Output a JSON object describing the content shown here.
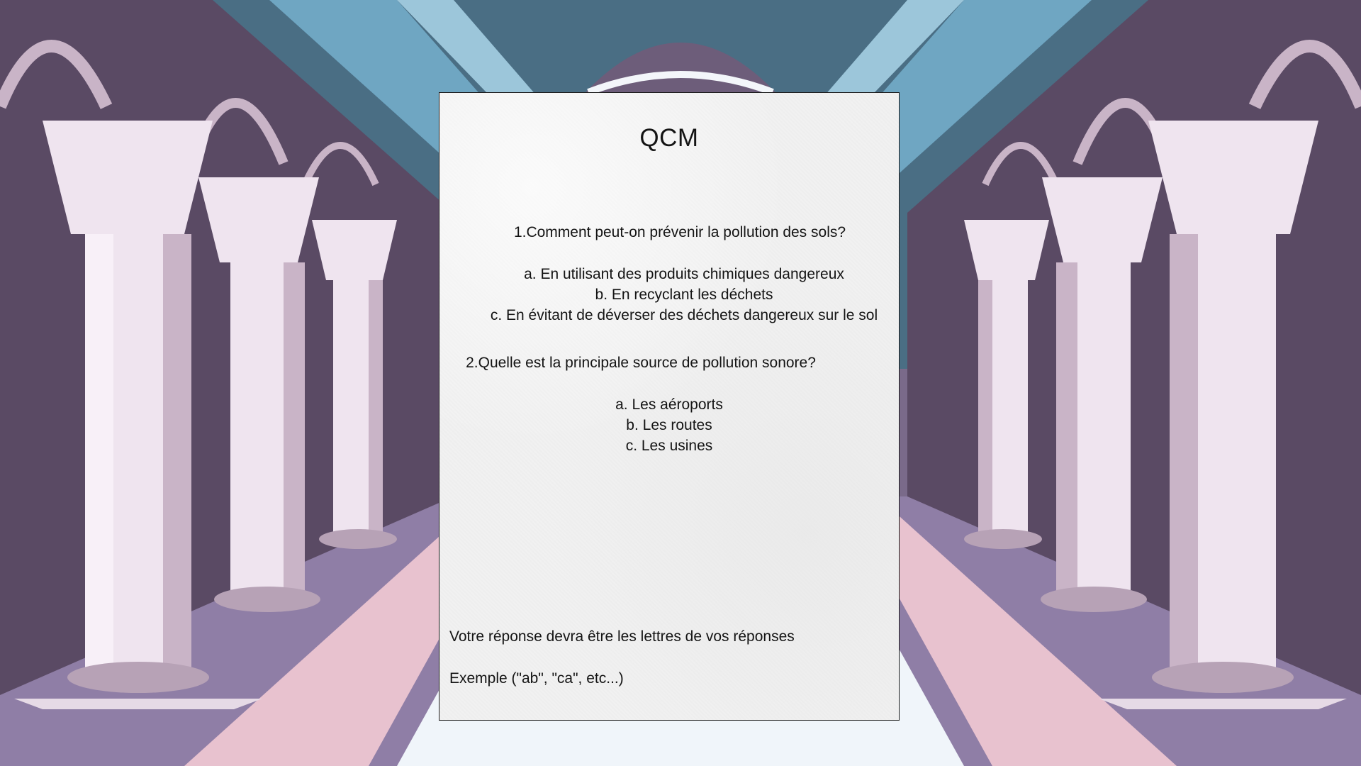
{
  "quiz": {
    "title": "QCM",
    "questions": [
      {
        "text": "1.Comment peut-on prévenir la pollution des sols?",
        "options": [
          "a. En utilisant des produits chimiques dangereux",
          "b. En recyclant les déchets",
          "c. En évitant de déverser des déchets dangereux sur le sol"
        ]
      },
      {
        "text": "2.Quelle est la principale source de pollution sonore?",
        "options": [
          "a. Les aéroports",
          "b. Les routes",
          "c. Les usines"
        ]
      }
    ],
    "instruction": "Votre réponse devra être les lettres de vos réponses",
    "example": "Exemple (\"ab\", \"ca\", etc...)"
  },
  "colors": {
    "sky": "#5f9fbd",
    "wall_dark": "#5a4a64",
    "column_light": "#efe4ef",
    "column_shadow": "#c9b4c7",
    "floor_purple": "#8f7ea6",
    "floor_pink": "#e8c2cf",
    "paper": "#f1f1f1"
  }
}
